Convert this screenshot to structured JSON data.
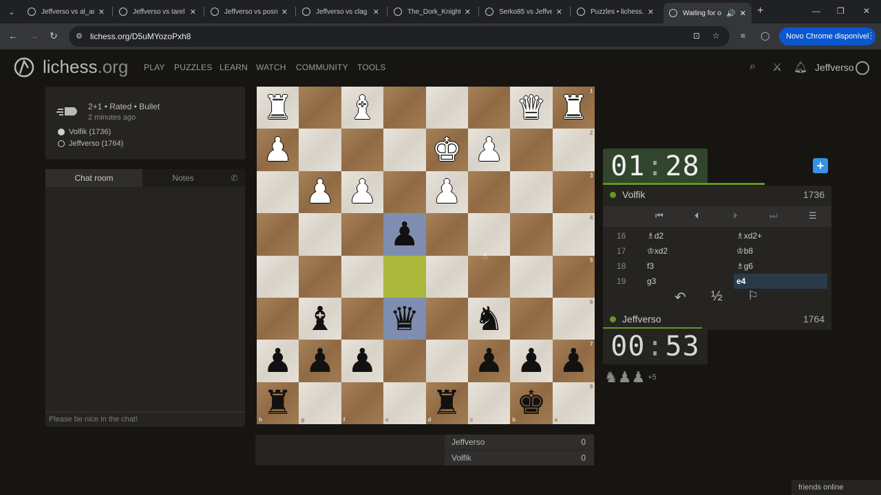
{
  "browser": {
    "tabs": [
      {
        "title": "Jeffverso vs al_ar"
      },
      {
        "title": "Jeffverso vs tarel"
      },
      {
        "title": "Jeffverso vs posn"
      },
      {
        "title": "Jeffverso vs clag"
      },
      {
        "title": "The_Dork_Knight"
      },
      {
        "title": "Serko85 vs Jeffve"
      },
      {
        "title": "Puzzles • lichess."
      },
      {
        "title": "Waiting for o"
      }
    ],
    "url": "lichess.org/D5uMYozoPxh8",
    "update_label": "Novo Chrome disponível"
  },
  "site": {
    "logo_main": "lichess",
    "logo_tld": ".org",
    "nav": [
      "PLAY",
      "PUZZLES",
      "LEARN",
      "WATCH",
      "COMMUNITY",
      "TOOLS"
    ],
    "username": "Jeffverso"
  },
  "game": {
    "meta": "2+1 • Rated • Bullet",
    "time_ago": "2 minutes ago",
    "white_player": "Volfik (1736)",
    "black_player": "Jeffverso (1764)"
  },
  "chat": {
    "tab_room": "Chat room",
    "tab_notes": "Notes",
    "placeholder": "Please be nice in the chat!"
  },
  "board": {
    "orientation": "black",
    "colors": {
      "light": "#e4dfd6",
      "dark": "#9c7650",
      "last_move_from": "#7f8eb0",
      "last_move_to": "#aab83b"
    },
    "rank_labels": [
      "1",
      "2",
      "3",
      "4",
      "5",
      "6",
      "7",
      "8"
    ],
    "file_labels": [
      "h",
      "g",
      "f",
      "e",
      "d",
      "c",
      "b",
      "a"
    ]
  },
  "scores": [
    {
      "name": "Jeffverso",
      "score": "0"
    },
    {
      "name": "Volfik",
      "score": "0"
    }
  ],
  "opponent": {
    "name": "Volfik",
    "rating": "1736",
    "clock_min": "01",
    "clock_sec": "28"
  },
  "me": {
    "name": "Jeffverso",
    "rating": "1764",
    "clock_min": "00",
    "clock_sec": "53"
  },
  "moves": [
    {
      "num": "16",
      "white": "♗d2",
      "black": "♗xd2+"
    },
    {
      "num": "17",
      "white": "♔xd2",
      "black": "♔b8"
    },
    {
      "num": "18",
      "white": "f3",
      "black": "♗g6"
    },
    {
      "num": "19",
      "white": "g3",
      "black": "e4"
    }
  ],
  "material": {
    "pieces": "♞♟♟",
    "diff": "+5"
  },
  "footer": {
    "friends": "friends online"
  }
}
